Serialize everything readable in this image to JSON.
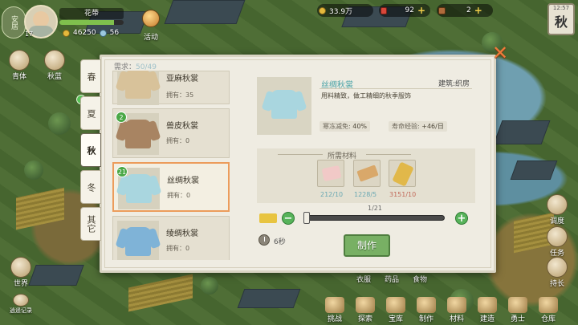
{
  "hud": {
    "season_badge": "安居",
    "level": "17",
    "player_name": "花带",
    "hp_fraction": 0.85,
    "resource_a": "46250",
    "resource_b": "56",
    "event_label": "活动",
    "copper": "33.9万",
    "gems": "92",
    "tickets": "2",
    "time_small": "12:57",
    "current_season": "秋",
    "left_buttons": [
      "青体",
      "秋蓝"
    ],
    "right_buttons": [
      "调度",
      "任务",
      "持长"
    ],
    "bottom_left": [
      "世界",
      "逍遥记录"
    ],
    "bottom_bar": [
      "挑战",
      "探索",
      "宝库",
      "制作",
      "材料",
      "建造",
      "勇士",
      "仓库"
    ],
    "map_labels": [
      "衣服",
      "药品",
      "食物"
    ]
  },
  "dialog": {
    "tabs": [
      "春",
      "夏",
      "秋",
      "冬",
      "其它"
    ],
    "active_tab": "秋",
    "needs_label": "需求：",
    "needs_value": "50/49",
    "items": [
      {
        "name": "亚麻秋裳",
        "own": "拥有：35",
        "badge": "",
        "color": "#d8c29a"
      },
      {
        "name": "兽皮秋裳",
        "own": "拥有：0",
        "badge": "2",
        "color": "#a88462"
      },
      {
        "name": "丝绸秋裳",
        "own": "拥有：0",
        "badge": "21",
        "color": "#a9d6df",
        "selected": true
      },
      {
        "name": "绫绸秋裳",
        "own": "拥有：0",
        "badge": "",
        "color": "#7fb3d7"
      }
    ],
    "detail": {
      "title": "丝绸秋裳",
      "building": "建筑:织房",
      "description": "用料精致，做工精细的秋季服饰",
      "attr1_label": "寒冻减免:",
      "attr1_value": "40%",
      "attr2_label": "寿命经验:",
      "attr2_value": "+46/日",
      "materials_title": "所需材料",
      "materials": [
        {
          "icon": "silk-cloth-icon",
          "count": "212/10",
          "ok": true
        },
        {
          "icon": "scroll-icon",
          "count": "1228/5",
          "ok": true
        },
        {
          "icon": "thread-spool-icon",
          "count": "3151/10",
          "ok": false
        }
      ],
      "slider_count": "1/21",
      "slider_fraction": 0.0,
      "craft_time": "6秒",
      "make_label": "制作"
    }
  }
}
